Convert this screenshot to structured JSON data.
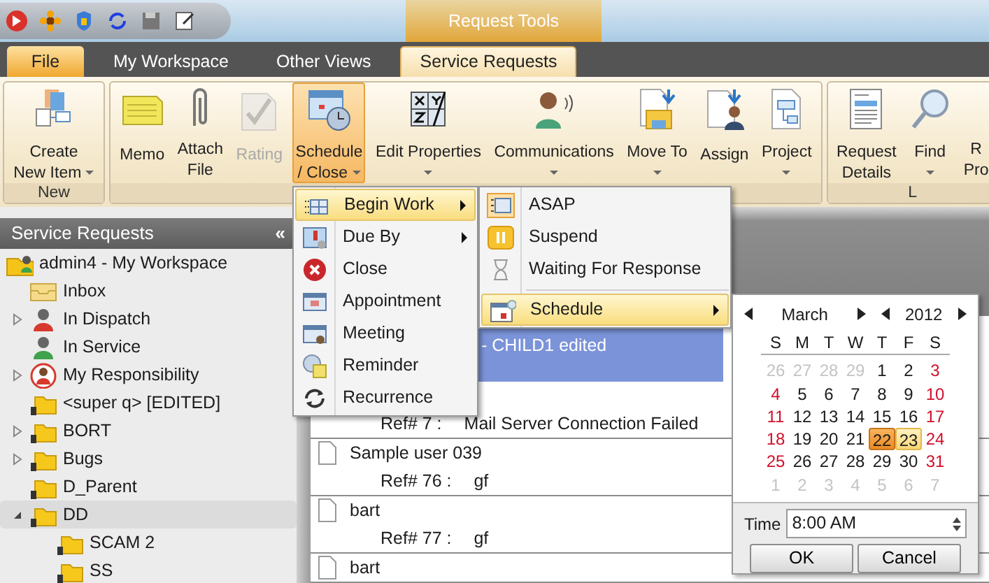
{
  "title_bar": {
    "contextual_tab": "Request Tools"
  },
  "tabs": [
    {
      "label": "File",
      "kind": "file",
      "selected": false
    },
    {
      "label": "My Workspace",
      "kind": "tab",
      "selected": false
    },
    {
      "label": "Other Views",
      "kind": "tab",
      "selected": false
    },
    {
      "label": "Service Requests",
      "kind": "tab",
      "selected": true
    }
  ],
  "ribbon": {
    "groups": [
      {
        "label": "New",
        "buttons": [
          {
            "lines": [
              "Create",
              "New Item"
            ],
            "dropdown": true,
            "disabled": false,
            "pressed": false
          }
        ]
      },
      {
        "buttons": [
          {
            "lines": [
              "Memo"
            ],
            "dropdown": false,
            "disabled": false,
            "pressed": false
          },
          {
            "lines": [
              "Attach",
              "File"
            ],
            "dropdown": false,
            "disabled": false,
            "pressed": false
          },
          {
            "lines": [
              "Rating"
            ],
            "dropdown": false,
            "disabled": true,
            "pressed": false
          },
          {
            "lines": [
              "Schedule",
              "/ Close"
            ],
            "dropdown": true,
            "disabled": false,
            "pressed": true
          },
          {
            "lines": [
              "Edit Properties"
            ],
            "dropdown": true,
            "disabled": false,
            "pressed": false
          },
          {
            "lines": [
              "Communications"
            ],
            "dropdown": true,
            "disabled": false,
            "pressed": false
          },
          {
            "lines": [
              "Move To"
            ],
            "dropdown": true,
            "disabled": false,
            "pressed": false
          },
          {
            "lines": [
              "Assign"
            ],
            "dropdown": false,
            "disabled": false,
            "pressed": false
          },
          {
            "lines": [
              "Project"
            ],
            "dropdown": true,
            "disabled": false,
            "pressed": false
          }
        ]
      },
      {
        "label": "L",
        "buttons": [
          {
            "lines": [
              "Request",
              "Details"
            ],
            "dropdown": false,
            "disabled": false,
            "pressed": false
          },
          {
            "lines": [
              "Find"
            ],
            "dropdown": true,
            "disabled": false,
            "pressed": false
          },
          {
            "lines": [
              "R",
              "Pro"
            ],
            "dropdown": false,
            "disabled": false,
            "pressed": false
          }
        ]
      }
    ]
  },
  "left_panel": {
    "title": "Service Requests",
    "collapse": "«",
    "tree": [
      {
        "label": "admin4 - My Workspace",
        "kind": "workspace",
        "selected": false,
        "children": [
          {
            "label": "Inbox",
            "kind": "inbox",
            "selected": false
          },
          {
            "label": "In Dispatch",
            "kind": "dispatch",
            "selected": false,
            "expanded": false
          },
          {
            "label": "In Service",
            "kind": "service",
            "selected": false
          },
          {
            "label": "My Responsibility",
            "kind": "responsibility",
            "selected": false,
            "expanded": false
          },
          {
            "label": "<super q> [EDITED]",
            "kind": "folder",
            "selected": false
          },
          {
            "label": "BORT",
            "kind": "folder",
            "selected": false,
            "expanded": false
          },
          {
            "label": "Bugs",
            "kind": "folder",
            "selected": false,
            "expanded": false
          },
          {
            "label": "D_Parent",
            "kind": "folder",
            "selected": false
          },
          {
            "label": "DD",
            "kind": "folder",
            "selected": true,
            "expanded": true,
            "children": [
              {
                "label": "SCAM 2",
                "kind": "folder",
                "selected": false
              },
              {
                "label": "SS",
                "kind": "folder",
                "selected": false
              }
            ]
          }
        ]
      }
    ]
  },
  "request_list": {
    "rows": [
      {
        "title": "- CHILD1 edited",
        "ref": "Ref# 7 :",
        "subject": "Mail Server Connection Failed",
        "selected": true
      },
      {
        "title": "Sample user 039",
        "ref": "Ref# 76 :",
        "subject": "gf",
        "selected": false
      },
      {
        "title": "bart",
        "ref": "Ref# 77 :",
        "subject": "gf",
        "selected": false
      },
      {
        "title": "bart",
        "selected": false
      }
    ]
  },
  "context_menu": {
    "items": [
      {
        "label": "Begin Work",
        "submenu": true,
        "selected": true
      },
      {
        "label": "Due By",
        "submenu": true,
        "selected": false
      },
      {
        "label": "Close",
        "submenu": false,
        "selected": false
      },
      {
        "label": "Appointment",
        "submenu": false,
        "selected": false
      },
      {
        "label": "Meeting",
        "submenu": false,
        "selected": false
      },
      {
        "label": "Reminder",
        "submenu": false,
        "selected": false
      },
      {
        "label": "Recurrence",
        "submenu": false,
        "selected": false
      }
    ]
  },
  "submenu": {
    "items": [
      {
        "label": "ASAP",
        "submenu": false,
        "selected": false
      },
      {
        "label": "Suspend",
        "submenu": false,
        "selected": false
      },
      {
        "label": "Waiting For Response",
        "submenu": false,
        "selected": false
      },
      {
        "label": "Schedule",
        "submenu": true,
        "selected": true,
        "separator_before": true
      }
    ]
  },
  "calendar": {
    "month": "March",
    "year": "2012",
    "weekdays": [
      "S",
      "M",
      "T",
      "W",
      "T",
      "F",
      "S"
    ],
    "days": [
      {
        "day": "26",
        "kind": "other",
        "selected": false,
        "hovered": false
      },
      {
        "day": "27",
        "kind": "other",
        "selected": false,
        "hovered": false
      },
      {
        "day": "28",
        "kind": "other",
        "selected": false,
        "hovered": false
      },
      {
        "day": "29",
        "kind": "other",
        "selected": false,
        "hovered": false
      },
      {
        "day": "1",
        "kind": "weekday",
        "selected": false,
        "hovered": false
      },
      {
        "day": "2",
        "kind": "weekday",
        "selected": false,
        "hovered": false
      },
      {
        "day": "3",
        "kind": "weekend",
        "selected": false,
        "hovered": false
      },
      {
        "day": "4",
        "kind": "weekend",
        "selected": false,
        "hovered": false
      },
      {
        "day": "5",
        "kind": "weekday",
        "selected": false,
        "hovered": false
      },
      {
        "day": "6",
        "kind": "weekday",
        "selected": false,
        "hovered": false
      },
      {
        "day": "7",
        "kind": "weekday",
        "selected": false,
        "hovered": false
      },
      {
        "day": "8",
        "kind": "weekday",
        "selected": false,
        "hovered": false
      },
      {
        "day": "9",
        "kind": "weekday",
        "selected": false,
        "hovered": false
      },
      {
        "day": "10",
        "kind": "weekend",
        "selected": false,
        "hovered": false
      },
      {
        "day": "11",
        "kind": "weekend",
        "selected": false,
        "hovered": false
      },
      {
        "day": "12",
        "kind": "weekday",
        "selected": false,
        "hovered": false
      },
      {
        "day": "13",
        "kind": "weekday",
        "selected": false,
        "hovered": false
      },
      {
        "day": "14",
        "kind": "weekday",
        "selected": false,
        "hovered": false
      },
      {
        "day": "15",
        "kind": "weekday",
        "selected": false,
        "hovered": false
      },
      {
        "day": "16",
        "kind": "weekday",
        "selected": false,
        "hovered": false
      },
      {
        "day": "17",
        "kind": "weekend",
        "selected": false,
        "hovered": false
      },
      {
        "day": "18",
        "kind": "weekend",
        "selected": false,
        "hovered": false
      },
      {
        "day": "19",
        "kind": "weekday",
        "selected": false,
        "hovered": false
      },
      {
        "day": "20",
        "kind": "weekday",
        "selected": false,
        "hovered": false
      },
      {
        "day": "21",
        "kind": "weekday",
        "selected": false,
        "hovered": false
      },
      {
        "day": "22",
        "kind": "weekday",
        "selected": true,
        "hovered": false
      },
      {
        "day": "23",
        "kind": "weekday",
        "selected": false,
        "hovered": true
      },
      {
        "day": "24",
        "kind": "weekend",
        "selected": false,
        "hovered": false
      },
      {
        "day": "25",
        "kind": "weekend",
        "selected": false,
        "hovered": false
      },
      {
        "day": "26",
        "kind": "weekday",
        "selected": false,
        "hovered": false
      },
      {
        "day": "27",
        "kind": "weekday",
        "selected": false,
        "hovered": false
      },
      {
        "day": "28",
        "kind": "weekday",
        "selected": false,
        "hovered": false
      },
      {
        "day": "29",
        "kind": "weekday",
        "selected": false,
        "hovered": false
      },
      {
        "day": "30",
        "kind": "weekday",
        "selected": false,
        "hovered": false
      },
      {
        "day": "31",
        "kind": "weekend",
        "selected": false,
        "hovered": false
      },
      {
        "day": "1",
        "kind": "other",
        "selected": false,
        "hovered": false
      },
      {
        "day": "2",
        "kind": "other",
        "selected": false,
        "hovered": false
      },
      {
        "day": "3",
        "kind": "other",
        "selected": false,
        "hovered": false
      },
      {
        "day": "4",
        "kind": "other",
        "selected": false,
        "hovered": false
      },
      {
        "day": "5",
        "kind": "other",
        "selected": false,
        "hovered": false
      },
      {
        "day": "6",
        "kind": "other",
        "selected": false,
        "hovered": false
      },
      {
        "day": "7",
        "kind": "other",
        "selected": false,
        "hovered": false
      }
    ],
    "time_label": "Time",
    "time_value": "8:00 AM",
    "buttons": [
      "OK",
      "Cancel"
    ]
  }
}
